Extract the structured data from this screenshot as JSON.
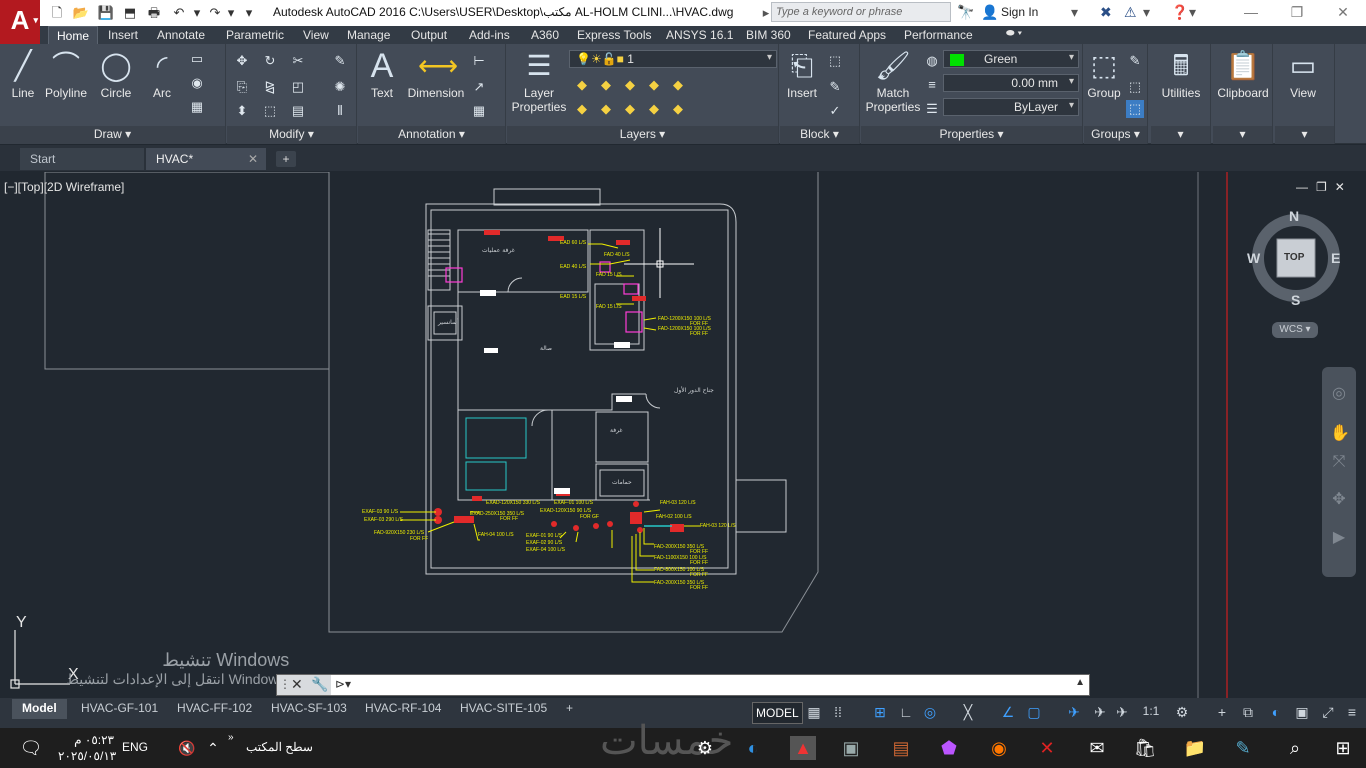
{
  "titlebar": {
    "logo": "A",
    "title": "Autodesk AutoCAD 2016    C:\\Users\\USER\\Desktop\\مكتب AL-HOLM CLINI...\\HVAC.dwg",
    "search_placeholder": "Type a keyword or phrase",
    "sign_in": "Sign In"
  },
  "ribbon_tabs": [
    "Home",
    "Insert",
    "Annotate",
    "Parametric",
    "View",
    "Manage",
    "Output",
    "Add-ins",
    "A360",
    "Express Tools",
    "ANSYS 16.1",
    "BIM 360",
    "Featured Apps",
    "Performance"
  ],
  "panels": {
    "draw": {
      "title": "Draw",
      "tools": [
        "Line",
        "Polyline",
        "Circle",
        "Arc"
      ]
    },
    "modify": {
      "title": "Modify"
    },
    "annotation": {
      "title": "Annotation",
      "tools": [
        "Text",
        "Dimension"
      ]
    },
    "layers": {
      "title": "Layers",
      "tool": "Layer Properties",
      "layer_value": "1"
    },
    "block": {
      "title": "Block",
      "tool": "Insert"
    },
    "properties": {
      "title": "Properties",
      "tool": "Match Properties",
      "color": "Green",
      "lineweight": "0.00 mm",
      "linetype": "ByLayer"
    },
    "groups": {
      "title": "Groups",
      "tool": "Group"
    },
    "utilities": {
      "tool": "Utilities"
    },
    "clipboard": {
      "tool": "Clipboard"
    },
    "view": {
      "tool": "View"
    }
  },
  "file_tabs": [
    {
      "label": "Start"
    },
    {
      "label": "HVAC*"
    }
  ],
  "viewport": {
    "label": "[−][Top][2D Wireframe]",
    "viewcube": {
      "top": "TOP",
      "n": "N",
      "s": "S",
      "e": "E",
      "w": "W"
    },
    "wcs": "WCS",
    "ucs_x": "X",
    "ucs_y": "Y"
  },
  "drawing": {
    "rooms": [
      "غرفة عمليات",
      "صالة",
      "جناح الدور الأول",
      "غرفة",
      "حمامات",
      "أسانسير"
    ],
    "annotations_top": [
      "EAD 60 L/S",
      "EAD 40 L/S",
      "FAD 40 L/S",
      "FAD 15 L/S",
      "EAD 15 L/S",
      "EAD 40 L/S",
      "FAD 15 L/S"
    ],
    "annotations_mid": [
      "FAD-1200X150 100 L/S",
      "FOR FF",
      "FAD-1200X150 100 L/S",
      "FOR FF"
    ],
    "annotations_left": [
      "EXAF-03 90 L/S",
      "EXAF-03 290 L/S",
      "FAD-920X150 230 L/S",
      "FOR FF"
    ],
    "annotations_bottom": [
      "EXAD-120X150 330 L/S",
      "EXAF-01 100 L/S",
      "EXAD-250X150 350 L/S",
      "EXAD-120X150 90 L/S",
      "FOR FF",
      "FOR GF",
      "FAH-03 120 L/S",
      "FAH-01 300 L/S",
      "FAH-04 100 L/S",
      "EXAF-01 90 L/S",
      "EXAF-02 90 L/S",
      "EXAF-04 100 L/S",
      "FAH-03 120 L/S",
      "FAH-02 100 L/S"
    ],
    "annotations_right": [
      "FAD-200X150 350 L/S",
      "FOR FF",
      "FAD-1100X150 100 L/S",
      "FOR FF",
      "FAD-800X150 100 L/S",
      "FOR FF",
      "FAD-200X150 350 L/S",
      "FOR FF"
    ]
  },
  "command_line": {
    "value": ""
  },
  "activation": {
    "line1": "تنشيط Windows",
    "line2": "انتقل إلى الإعدادات لتنشيط Windows."
  },
  "layout_tabs": [
    "Model",
    "HVAC-GF-101",
    "HVAC-FF-102",
    "HVAC-SF-103",
    "HVAC-RF-104",
    "HVAC-SITE-105"
  ],
  "status": {
    "model": "MODEL",
    "scale": "1:1"
  },
  "taskbar": {
    "time": "٠٥:٢٣ م",
    "date": "٢٠٢٥/٠٥/١٣",
    "lang": "ENG",
    "desktop": "سطح المكتب",
    "watermark": "خمسات"
  },
  "colors": {
    "canvas": "#212830",
    "ribbon": "#434b57",
    "annotation": "#f0f000",
    "red_axis": "#cc1f1f",
    "brand_red": "#b3191f"
  }
}
